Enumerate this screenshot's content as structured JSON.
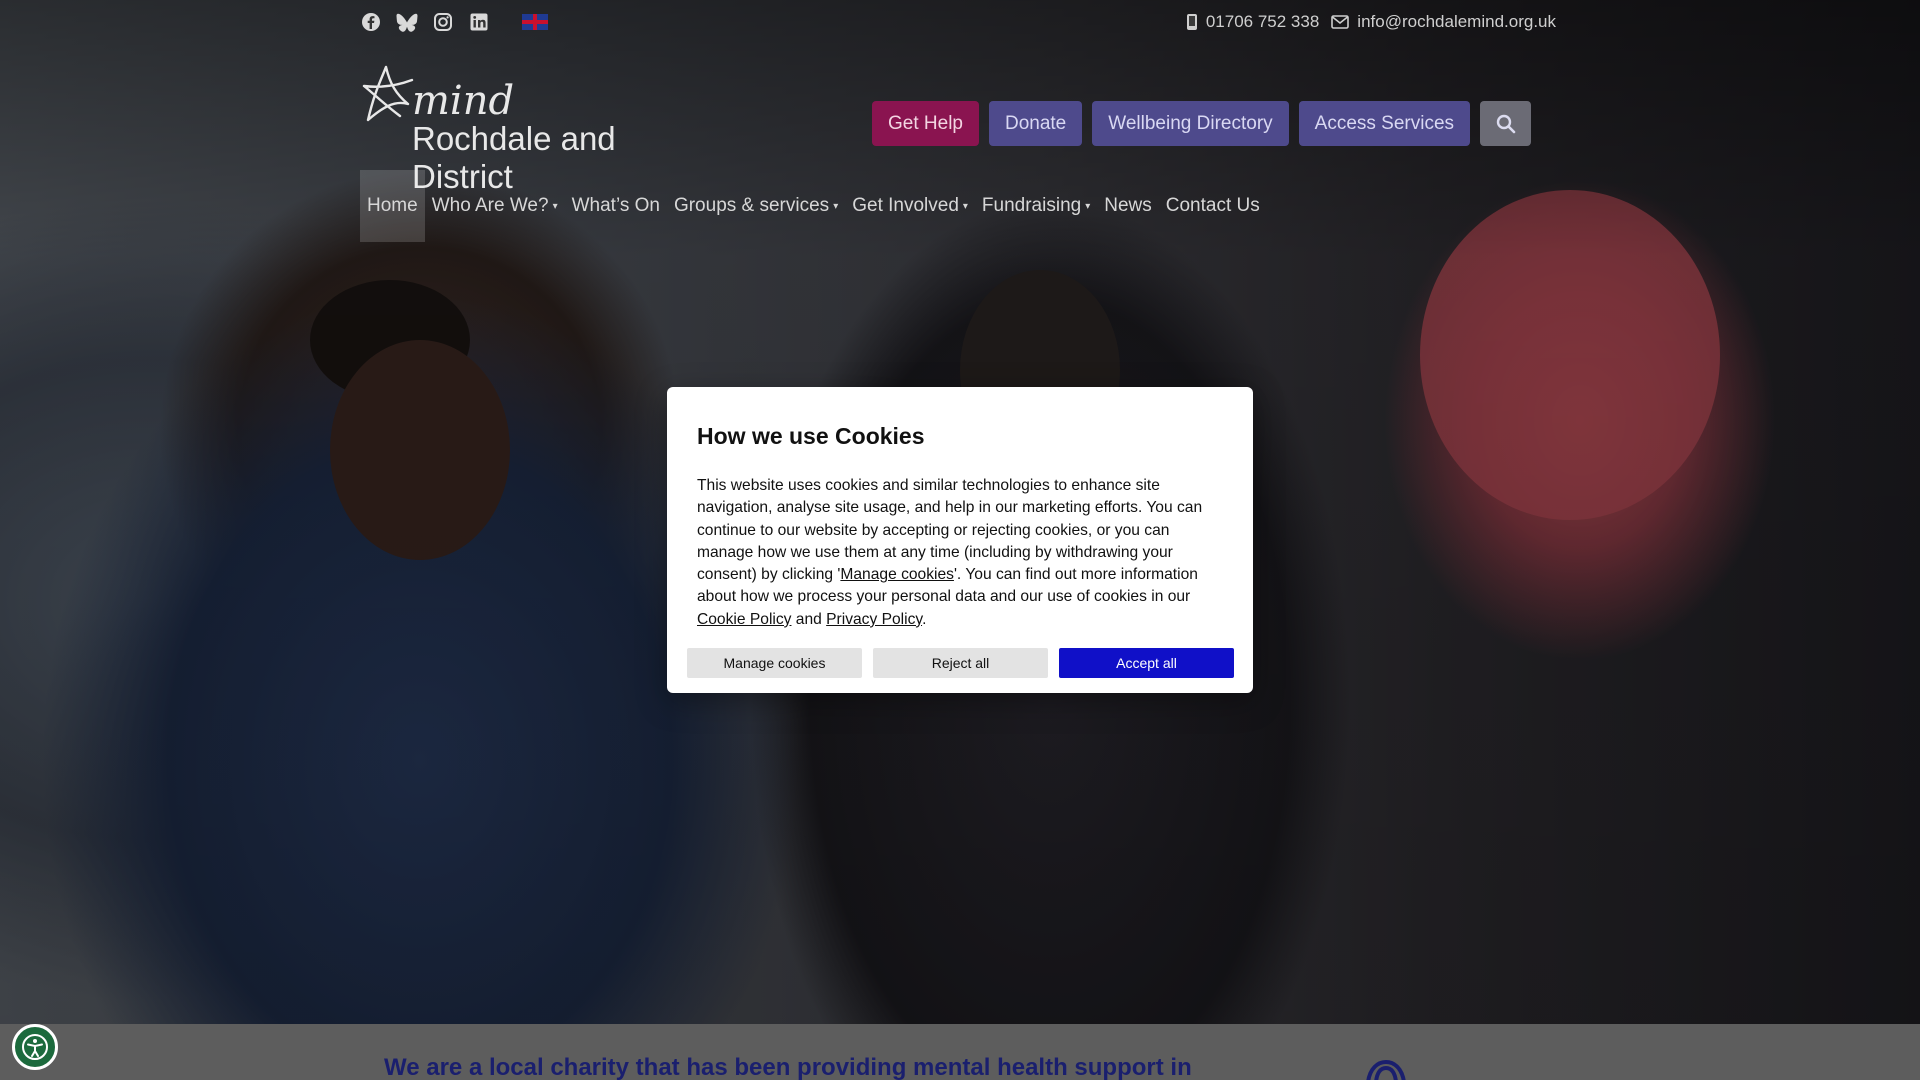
{
  "topbar": {
    "social": [
      {
        "icon": "facebook-icon"
      },
      {
        "icon": "bluesky-butterfly-icon"
      },
      {
        "icon": "instagram-icon"
      },
      {
        "icon": "linkedin-icon"
      }
    ],
    "language_flag": "uk-flag-icon",
    "phone": "01706 752 338",
    "email": "info@rochdalemind.org.uk"
  },
  "logo": {
    "mind": "mind",
    "district": "Rochdale and District"
  },
  "actions": {
    "get_help": "Get Help",
    "donate": "Donate",
    "wellbeing_directory": "Wellbeing Directory",
    "access_services": "Access Services"
  },
  "nav": {
    "items": [
      {
        "label": "Home",
        "dropdown": false
      },
      {
        "label": "Who Are We?",
        "dropdown": true
      },
      {
        "label": "What’s On",
        "dropdown": false
      },
      {
        "label": "Groups & services",
        "dropdown": true
      },
      {
        "label": "Get Involved",
        "dropdown": true
      },
      {
        "label": "Fundraising",
        "dropdown": true
      },
      {
        "label": "News",
        "dropdown": false
      },
      {
        "label": "Contact Us",
        "dropdown": false
      }
    ]
  },
  "bottom": {
    "tagline": "We are a local charity that has been providing mental health support in"
  },
  "cookie_modal": {
    "title": "How we use Cookies",
    "text_1": "This website uses cookies and similar technologies to enhance site navigation, analyse site usage, and help in our marketing efforts. You can continue to our website by accepting or rejecting cookies, or you can manage how we use them at any time (including by withdrawing your consent) by clicking '",
    "manage_link": "Manage cookies",
    "text_2": "'. You can find out more information about how we process your personal data and our use of cookies in our ",
    "cookie_policy": "Cookie Policy",
    "text_and": " and ",
    "privacy_policy": "Privacy Policy",
    "text_end": ".",
    "manage_button": "Manage cookies",
    "reject_button": "Reject all",
    "accept_button": "Accept all"
  },
  "colors": {
    "get_help_bg": "#8a1450",
    "purple_button_bg": "#4e4a8c",
    "accept_bg": "#1010c8",
    "tagline": "#1a1f6e",
    "a11y_bg": "#1c6a3d"
  }
}
